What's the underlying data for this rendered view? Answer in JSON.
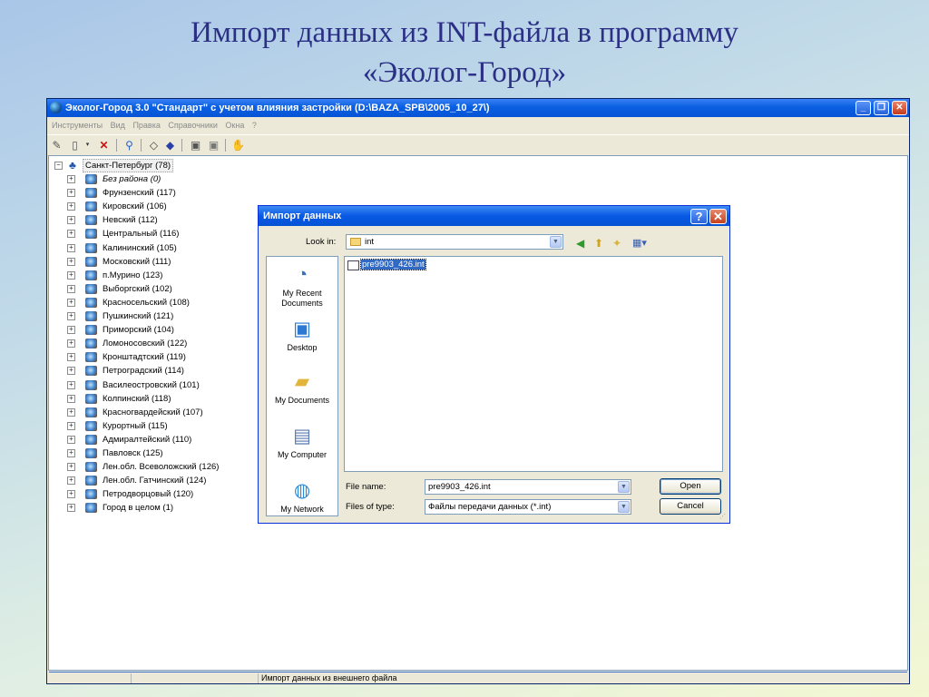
{
  "slide": {
    "title_line1": "Импорт данных из INT-файла в программу",
    "title_line2": "«Эколог-Город»"
  },
  "app": {
    "title": "Эколог-Город 3.0 \"Стандарт\" с учетом влияния застройки (D:\\BAZA_SPB\\2005_10_27\\)",
    "window_buttons": {
      "minimize": "_",
      "maximize": "❐",
      "close": "✕"
    },
    "menu": [
      "Инструменты",
      "Вид",
      "Правка",
      "Справочники",
      "Окна",
      "?"
    ],
    "tree": {
      "root": "Санкт-Петербург (78)",
      "items": [
        "Без района (0)",
        "Фрунзенский (117)",
        "Кировский (106)",
        "Невский (112)",
        "Центральный (116)",
        "Калининский (105)",
        "Московский (111)",
        "п.Мурино (123)",
        "Выборгский (102)",
        "Красносельский (108)",
        "Пушкинский (121)",
        "Приморский (104)",
        "Ломоносовский (122)",
        "Кронштадтский (119)",
        "Петроградский (114)",
        "Василеостровский (101)",
        "Колпинский (118)",
        "Красногвардейский (107)",
        "Курортный (115)",
        "Адмиралтейский (110)",
        "Павловск (125)",
        "Лен.обл. Всеволожский (126)",
        "Лен.обл. Гатчинский (124)",
        "Петродворцовый (120)",
        "Город в целом (1)"
      ]
    },
    "status": "Импорт данных из внешнего файла"
  },
  "dialog": {
    "title": "Импорт данных",
    "help_label": "?",
    "close_label": "✕",
    "look_in_label": "Look in:",
    "look_in_value": "int",
    "places": [
      "My Recent Documents",
      "Desktop",
      "My Documents",
      "My Computer",
      "My Network"
    ],
    "files": [
      "pre9903_426.int"
    ],
    "file_name_label": "File name:",
    "file_name_value": "pre9903_426.int",
    "file_type_label": "Files of type:",
    "file_type_value": "Файлы передачи данных (*.int)",
    "open_label": "Open",
    "cancel_label": "Cancel"
  }
}
